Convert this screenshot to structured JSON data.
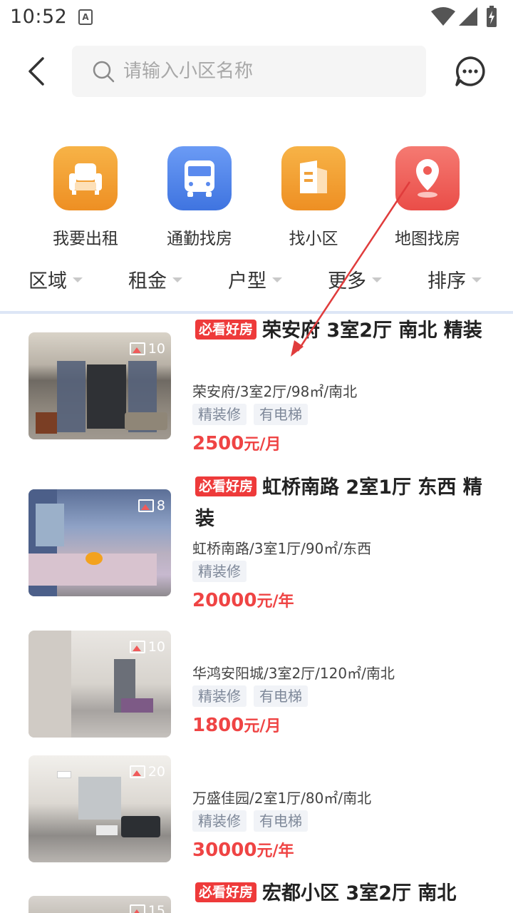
{
  "status": {
    "time": "10:52",
    "indicator": "A"
  },
  "search": {
    "placeholder": "请输入小区名称"
  },
  "quick_actions": [
    {
      "label": "我要出租",
      "icon": "sofa-icon",
      "color": "#f29a2e"
    },
    {
      "label": "通勤找房",
      "icon": "bus-icon",
      "color": "#4f86ec"
    },
    {
      "label": "找小区",
      "icon": "building-icon",
      "color": "#f29a2e"
    },
    {
      "label": "地图找房",
      "icon": "map-pin-icon",
      "color": "#f05f5a"
    }
  ],
  "filters": [
    "区域",
    "租金",
    "户型",
    "更多",
    "排序"
  ],
  "listings": [
    {
      "badge": "必看好房",
      "title": "荣安府 3室2厅 南北 精装",
      "sub": "荣安府/3室2厅/98㎡/南北",
      "tags": [
        "精装修",
        "有电梯"
      ],
      "price": "2500",
      "unit": "元/月",
      "photos": "10"
    },
    {
      "badge": "必看好房",
      "title": "虹桥南路 2室1厅 东西 精装",
      "sub": "虹桥南路/3室1厅/90㎡/东西",
      "tags": [
        "精装修"
      ],
      "price": "20000",
      "unit": "元/年",
      "photos": "8"
    },
    {
      "badge": "",
      "title": "",
      "sub": "华鸿安阳城/3室2厅/120㎡/南北",
      "tags": [
        "精装修",
        "有电梯"
      ],
      "price": "1800",
      "unit": "元/月",
      "photos": "10"
    },
    {
      "badge": "",
      "title": "",
      "sub": "万盛佳园/2室1厅/80㎡/南北",
      "tags": [
        "精装修",
        "有电梯"
      ],
      "price": "30000",
      "unit": "元/年",
      "photos": "20"
    },
    {
      "badge": "必看好房",
      "title": "宏都小区 3室2厅 南北",
      "sub": "",
      "tags": [],
      "price": "",
      "unit": "",
      "photos": "15"
    }
  ],
  "colors": {
    "accent": "#ef4444",
    "badge": "#ee3a3a",
    "divider": "#dde6f6"
  }
}
